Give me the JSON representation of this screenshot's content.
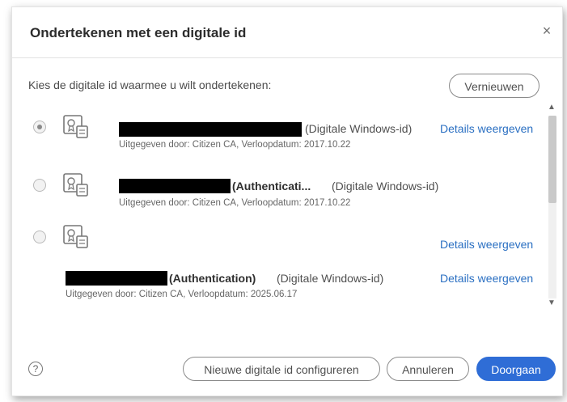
{
  "dialog": {
    "title": "Ondertekenen met een digitale id",
    "close_label": "×",
    "prompt": "Kies de digitale id waarmee u wilt ondertekenen:",
    "refresh_label": "Vernieuwen"
  },
  "certificates": [
    {
      "name_bold": "",
      "type": "(Digitale Windows-id)",
      "issued_by": "Uitgegeven door: Citizen CA, Verloopdatum: 2017.10.22",
      "details_label": "Details weergeven",
      "selected": true
    },
    {
      "name_bold": "(Authenticati...",
      "type": "(Digitale Windows-id)",
      "issued_by": "Uitgegeven door: Citizen CA, Verloopdatum: 2017.10.22",
      "details_label": "",
      "selected": false
    },
    {
      "name_bold": "",
      "type": "",
      "issued_by": "",
      "details_label": "Details weergeven",
      "selected": false
    },
    {
      "name_bold": "(Authentication)",
      "type": "(Digitale Windows-id)",
      "issued_by": "Uitgegeven door: Citizen CA, Verloopdatum: 2025.06.17",
      "details_label": "Details weergeven",
      "selected": false
    }
  ],
  "footer": {
    "help_label": "?",
    "configure_label": "Nieuwe digitale id configureren",
    "cancel_label": "Annuleren",
    "continue_label": "Doorgaan"
  },
  "icons": {
    "close": "close-icon",
    "help": "help-icon",
    "certificate": "certificate-icon",
    "scroll_up": "chevron-up-icon",
    "scroll_down": "chevron-down-icon"
  },
  "colors": {
    "accent": "#2f6dd6",
    "link": "#2a6fc2",
    "redaction": "#000000"
  }
}
